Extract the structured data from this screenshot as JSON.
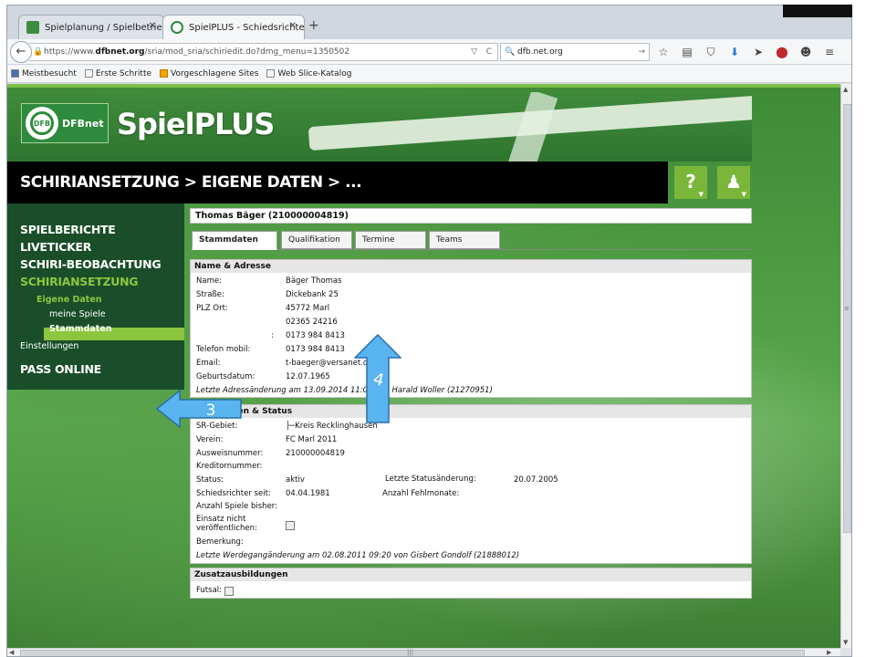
{
  "browser": {
    "tabs": [
      {
        "title": "Spielplanung / Spielbetrieb..."
      },
      {
        "title": "SpielPLUS - Schiedsrichtera..."
      }
    ],
    "url_prefix": "https://www.",
    "url_host": "dfbnet.org",
    "url_path": "/sria/mod_sria/schiriedit.do?dmg_menu=1350502",
    "search_value": "dfb.net.org",
    "bookmarks": [
      "Meistbesucht",
      "Erste Schritte",
      "Vorgeschlagene Sites",
      "Web Slice-Katalog"
    ]
  },
  "header": {
    "logo_text": "DFBnet",
    "logo_mark": "DFB",
    "brand": "SpielPLUS",
    "breadcrumb": "SCHIRIANSETZUNG > EIGENE DATEN > ...",
    "help_label": "?",
    "user_label": "♟"
  },
  "nav": {
    "main": [
      "SPIELBERICHTE",
      "LIVETICKER",
      "SCHIRI-BEOBACHTUNG",
      "SCHIRIANSETZUNG"
    ],
    "sub_group": "Eigene Daten",
    "sub_items": [
      "meine Spiele",
      "Stammdaten"
    ],
    "settings": "Einstellungen",
    "pass": "PASS ONLINE"
  },
  "person": {
    "title": "Thomas Bäger (210000004819)"
  },
  "content_tabs": [
    "Stammdaten",
    "Qualifikation",
    "Termine",
    "Teams"
  ],
  "address": {
    "heading": "Name & Adresse",
    "labels": [
      "Name:",
      "Straße:",
      "PLZ Ort:",
      "",
      "",
      "Telefon mobil:",
      "Email:",
      "Geburtsdatum:"
    ],
    "values": [
      "Bäger Thomas",
      "Dickebank 25",
      "45772 Marl",
      "02365 24216",
      "0173 984 8413",
      "0173 984 8413",
      "t-baeger@versanet.de",
      "12.07.1965"
    ],
    "partial_label": ":",
    "note": "Letzte Adressänderung am 13.09.2014 11:04 von Harald Woller (21270951)"
  },
  "meldedaten": {
    "heading": "Meldedaten & Status",
    "sr_gebiet_label": "SR-Gebiet:",
    "sr_gebiet_value": "├─Kreis Recklinghausen",
    "verein_label": "Verein:",
    "verein_value": "FC Marl 2011",
    "ausweis_label": "Ausweisnummer:",
    "ausweis_value": "210000004819",
    "kreditor_label": "Kreditornummer:",
    "status_label": "Status:",
    "status_value": "aktiv",
    "status_change_label": "Letzte Statusänderung:",
    "status_change_value": "20.07.2005",
    "sr_seit_label": "Schiedsrichter seit:",
    "sr_seit_value": "04.04.1981",
    "fehlmonate_label": "Anzahl Fehlmonate:",
    "spiele_label": "Anzahl Spiele bisher:",
    "einsatz_label_1": "Einsatz nicht",
    "einsatz_label_2": "veröffentlichen:",
    "bemerkung_label": "Bemerkung:",
    "note": "Letzte Werdegangänderung am 02.08.2011 09:20 von Gisbert Gondolf (21888012)"
  },
  "zusatz": {
    "heading": "Zusatzausbildungen",
    "futsal_label": "Futsal:"
  },
  "annotations": {
    "arrow_tab": "4",
    "arrow_nav": "3"
  },
  "colors": {
    "accent_green": "#8cc63f",
    "nav_bg": "#184b29",
    "arrow_blue": "#5ab4f0"
  }
}
